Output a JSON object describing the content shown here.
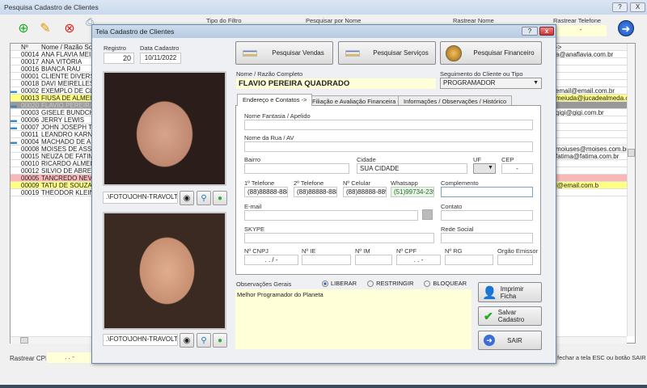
{
  "main_window": {
    "title": "Pesquisa Cadastro de Clientes",
    "help_label": "?",
    "close_label": "X",
    "toolbar_icons": [
      "add-document-icon",
      "edit-icon",
      "delete-document-icon",
      "print-icon",
      "folder-icon",
      "check-icon"
    ],
    "filters": {
      "tipo_filtro": "Tipo do Filtro",
      "pesquisar_nome": "Pesquisar por Nome",
      "rastrear_nome": "Rastrear Nome",
      "rastrear_telefone": "Rastrear Telefone",
      "telefone_value": "-"
    },
    "list": {
      "headers": [
        "Nº",
        "Nome / Razão Social"
      ],
      "email_header": "->",
      "rows": [
        {
          "id": "00014",
          "name": "ANA FLAVIA MEIRELES",
          "email": "a@anaflavia.com.br",
          "hl": ""
        },
        {
          "id": "00017",
          "name": "ANA VITÓRIA",
          "email": "",
          "hl": ""
        },
        {
          "id": "00016",
          "name": "BIANCA RAU",
          "email": "",
          "hl": ""
        },
        {
          "id": "00001",
          "name": "CLIENTE DIVERSOS",
          "email": "",
          "hl": ""
        },
        {
          "id": "00018",
          "name": "DAVI MEIRELLES",
          "email": "",
          "hl": ""
        },
        {
          "id": "00002",
          "name": "EXEMPLO DE CLIENTE",
          "email": "email@email.com.br",
          "hl": "",
          "icon": true
        },
        {
          "id": "00013",
          "name": "FIUSA DE ALMEIDA",
          "email": "meiuda@jucadealmeda.com.b",
          "hl": "yellow"
        },
        {
          "id": "00020",
          "name": "FLAVIO PEREIRA QUADRADO",
          "email": "",
          "hl": "selected",
          "icon": true
        },
        {
          "id": "00003",
          "name": "GISELE BUNDCHEN",
          "email": "gigi@gigi.com.br",
          "hl": ""
        },
        {
          "id": "00006",
          "name": "JERRY LEWIS",
          "email": "",
          "hl": "",
          "icon": true
        },
        {
          "id": "00007",
          "name": "JOHN JOSEPH TRAVOLTA",
          "email": "",
          "hl": "",
          "icon": true
        },
        {
          "id": "00011",
          "name": "LEANDRO KARNAL",
          "email": "",
          "hl": ""
        },
        {
          "id": "00004",
          "name": "MACHADO DE ASSIS",
          "email": "",
          "hl": "",
          "icon": true
        },
        {
          "id": "00008",
          "name": "MOISES DE ASSIS",
          "email": "moiuses@moises.com.br",
          "hl": ""
        },
        {
          "id": "00015",
          "name": "NEUZA DE FATIMA",
          "email": "fatima@fatima.com.br",
          "hl": ""
        },
        {
          "id": "00010",
          "name": "RICARDO ALMEIDA",
          "email": "",
          "hl": ""
        },
        {
          "id": "00012",
          "name": "SILVIO DE ABREU",
          "email": "",
          "hl": ""
        },
        {
          "id": "00005",
          "name": "TANCREDO NEVES",
          "email": "",
          "hl": "pink"
        },
        {
          "id": "00009",
          "name": "TATU DE SOUZA",
          "email": "l@email.com.b",
          "hl": "yellow"
        },
        {
          "id": "00019",
          "name": "THEODOR KLEIN",
          "email": "",
          "hl": ""
        }
      ]
    },
    "rastrear_cpf": {
      "label": "Rastrear CPF",
      "value": ". . -"
    },
    "hint": "fechar a tela ESC ou botão SAIR"
  },
  "dialog": {
    "title": "Tela Cadastro de Clientes",
    "help_label": "?",
    "close_label": "x",
    "registro": {
      "label": "Registro",
      "value": "20"
    },
    "data_cadastro": {
      "label": "Data Cadastro",
      "value": "10/11/2022"
    },
    "photo1_path": ".\\FOTO\\JOHN-TRAVOLTA2...",
    "photo2_path": ".\\FOTO\\JOHN-TRAVOLTA1...",
    "buttons": {
      "vendas": "Pesquisar Vendas",
      "servicos": "Pesquisar Serviços",
      "financeiro": "Pesquisar  Financeiro",
      "imprimir": "Imprimir Ficha",
      "salvar": "Salvar Cadastro",
      "sair": "SAIR"
    },
    "nome": {
      "label": "Nome / Razão Completo",
      "value": "FLAVIO PEREIRA QUADRADO"
    },
    "seguimento": {
      "label": "Seguimento do Cliente ou Tipo",
      "value": "PROGRAMADOR"
    },
    "tabs": [
      "Endereço e Contatos ->",
      "Filiação e Avaliação Financeira ->",
      "Informações / Observações / Histórico"
    ],
    "fields": {
      "fantasia": {
        "label": "Nome Fantasia / Apelido",
        "value": ""
      },
      "rua": {
        "label": "Nome da Rua / AV",
        "value": ""
      },
      "bairro": {
        "label": "Bairro",
        "value": ""
      },
      "cidade": {
        "label": "Cidade",
        "value": "SUA CIDADE"
      },
      "uf": {
        "label": "UF",
        "value": ""
      },
      "cep": {
        "label": "CEP",
        "value": "-"
      },
      "tel1": {
        "label": "1º Telefone",
        "value": "(88)88888-8888"
      },
      "tel2": {
        "label": "2º Telefone",
        "value": "(88)88888-8888"
      },
      "celular": {
        "label": "Nº Celular",
        "value": "(88)88888-8899"
      },
      "whatsapp": {
        "label": "Whatsapp",
        "value": "(51)99734-2390"
      },
      "complemento": {
        "label": "Complemento",
        "value": ""
      },
      "email": {
        "label": "E-mail",
        "value": ""
      },
      "contato": {
        "label": "Contato",
        "value": ""
      },
      "skype": {
        "label": "SKYPE",
        "value": ""
      },
      "rede": {
        "label": "Rede Social",
        "value": ""
      },
      "cnpj": {
        "label": "Nº CNPJ",
        "value": ". . / -"
      },
      "ie": {
        "label": "Nº IE",
        "value": ""
      },
      "im": {
        "label": "Nº IM",
        "value": ""
      },
      "cpf": {
        "label": "Nº CPF",
        "value": ". . -"
      },
      "rg": {
        "label": "Nº RG",
        "value": ""
      },
      "orgao": {
        "label": "Orgão Emissor",
        "value": ""
      }
    },
    "observacoes": {
      "label": "Observações Gerais",
      "value": "Melhor Programador do Planeta"
    },
    "status_options": [
      "LIBERAR",
      "RESTRINGIR",
      "BLOQUEAR"
    ],
    "status_selected": "LIBERAR"
  }
}
